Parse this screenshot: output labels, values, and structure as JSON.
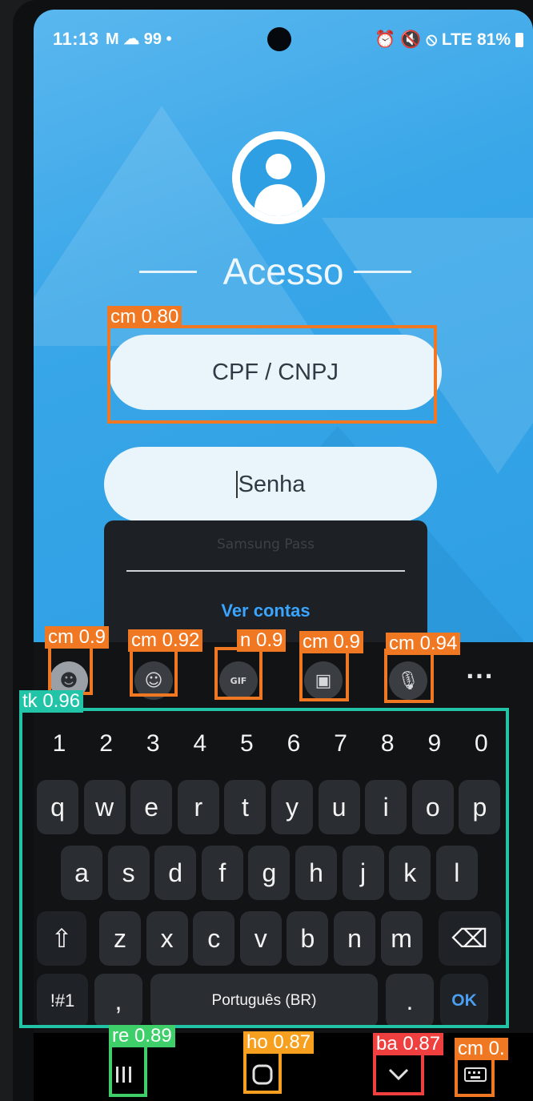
{
  "status_bar": {
    "time": "11:13",
    "left_icons": "M ☁ 99 •",
    "right_icons": "⏰ 🔇 ⦸ LTE",
    "battery": "81%"
  },
  "login": {
    "title": "Acesso",
    "cpf_placeholder": "CPF / CNPJ",
    "password_placeholder": "Senha"
  },
  "popup": {
    "title": "Samsung Pass",
    "link": "Ver contas"
  },
  "toolbar": {
    "icons": [
      "emoji-icon",
      "sticker-icon",
      "gif-icon",
      "clipboard-icon",
      "mic-icon",
      "more-icon"
    ],
    "more_label": "···",
    "gif_label": "GIF"
  },
  "keyboard": {
    "numbers": [
      "1",
      "2",
      "3",
      "4",
      "5",
      "6",
      "7",
      "8",
      "9",
      "0"
    ],
    "row1": [
      "q",
      "w",
      "e",
      "r",
      "t",
      "y",
      "u",
      "i",
      "o",
      "p"
    ],
    "row2": [
      "a",
      "s",
      "d",
      "f",
      "g",
      "h",
      "j",
      "k",
      "l"
    ],
    "row3": [
      "z",
      "x",
      "c",
      "v",
      "b",
      "n",
      "m"
    ],
    "symbols_label": "!#1",
    "comma": ",",
    "space_label": "Português (BR)",
    "period": ".",
    "ok_label": "OK",
    "shift_label": "⇧",
    "backspace_label": "⌫"
  },
  "navigation": {
    "recents_icon": "recents-icon",
    "home_icon": "home-icon",
    "back_icon": "back-icon",
    "keyboard_icon": "keyboard-switch-icon"
  },
  "detections": [
    {
      "label": "cm 0.80",
      "color": "#f07822"
    },
    {
      "label": "cm 0.9",
      "color": "#f07822"
    },
    {
      "label": "cm 0.92",
      "color": "#f07822"
    },
    {
      "label": "n 0.9",
      "color": "#f07822"
    },
    {
      "label": "cm 0.9",
      "color": "#f07822"
    },
    {
      "label": "cm 0.94",
      "color": "#f07822"
    },
    {
      "label": "tk 0.96",
      "color": "#22c4a8"
    },
    {
      "label": "re 0.89",
      "color": "#3ecf6a"
    },
    {
      "label": "ho 0.87",
      "color": "#f7a020"
    },
    {
      "label": "ba 0.87",
      "color": "#ef3f3f"
    },
    {
      "label": "cm 0.",
      "color": "#f07822"
    }
  ]
}
